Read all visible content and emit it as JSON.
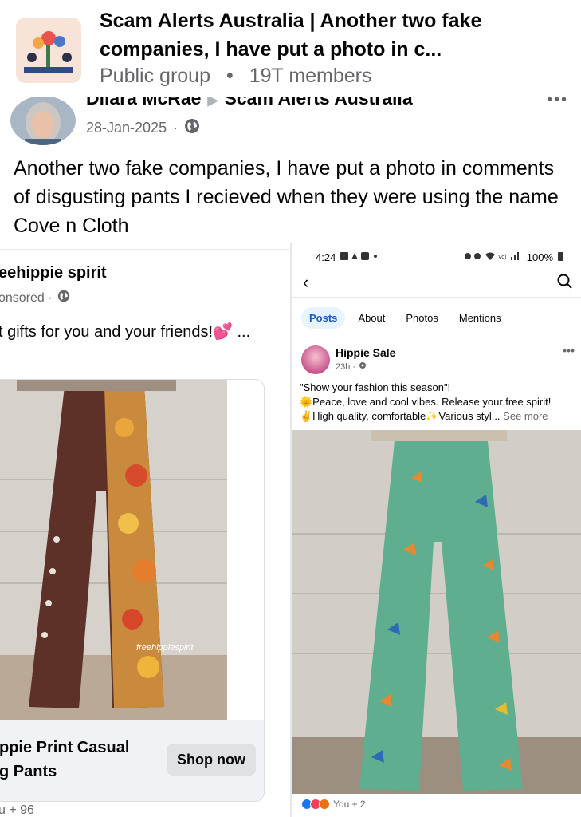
{
  "header": {
    "title": "Scam Alerts Australia | Another two fake companies, I have put a photo in c...",
    "privacy": "Public group",
    "separator": "•",
    "members": "19T members"
  },
  "post": {
    "author": "Dilara McRae",
    "group": "Scam Alerts Australia",
    "date": "28-Jan-2025",
    "date_separator": "·",
    "text": "Another two fake companies, I have put a photo in comments of disgusting pants I recieved when they were using the name Cove n Cloth",
    "more_icon": "more-horizontal-icon"
  },
  "left_ad": {
    "page_name": "eehippie spirit",
    "sponsored": "onsored ·",
    "caption": "t gifts for you and your friends!💕 ...",
    "watermark": "freehippiespirit",
    "product_line1": "ppie Print Casual",
    "product_line2": "g Pants",
    "button": "Shop now",
    "reactions": "u + 96"
  },
  "right_screenshot": {
    "status_time": "4:24",
    "status_battery": "100%",
    "tabs": [
      "Posts",
      "About",
      "Photos",
      "Mentions"
    ],
    "page_name": "Hippie Sale",
    "post_time": "23h ·",
    "line1": "\"Show your fashion this season\"!",
    "line2": "🌞Peace, love and cool vibes. Release your free spirit!",
    "line3": "✌️High quality, comfortable✨Various styl...",
    "see_more": "See more",
    "reactions": "You + 2"
  },
  "colors": {
    "text_primary": "#050505",
    "text_secondary": "#65676b",
    "link_blue": "#1a5fb4",
    "tab_active_bg": "#e7f3ff",
    "button_bg": "#dfe1e5"
  }
}
